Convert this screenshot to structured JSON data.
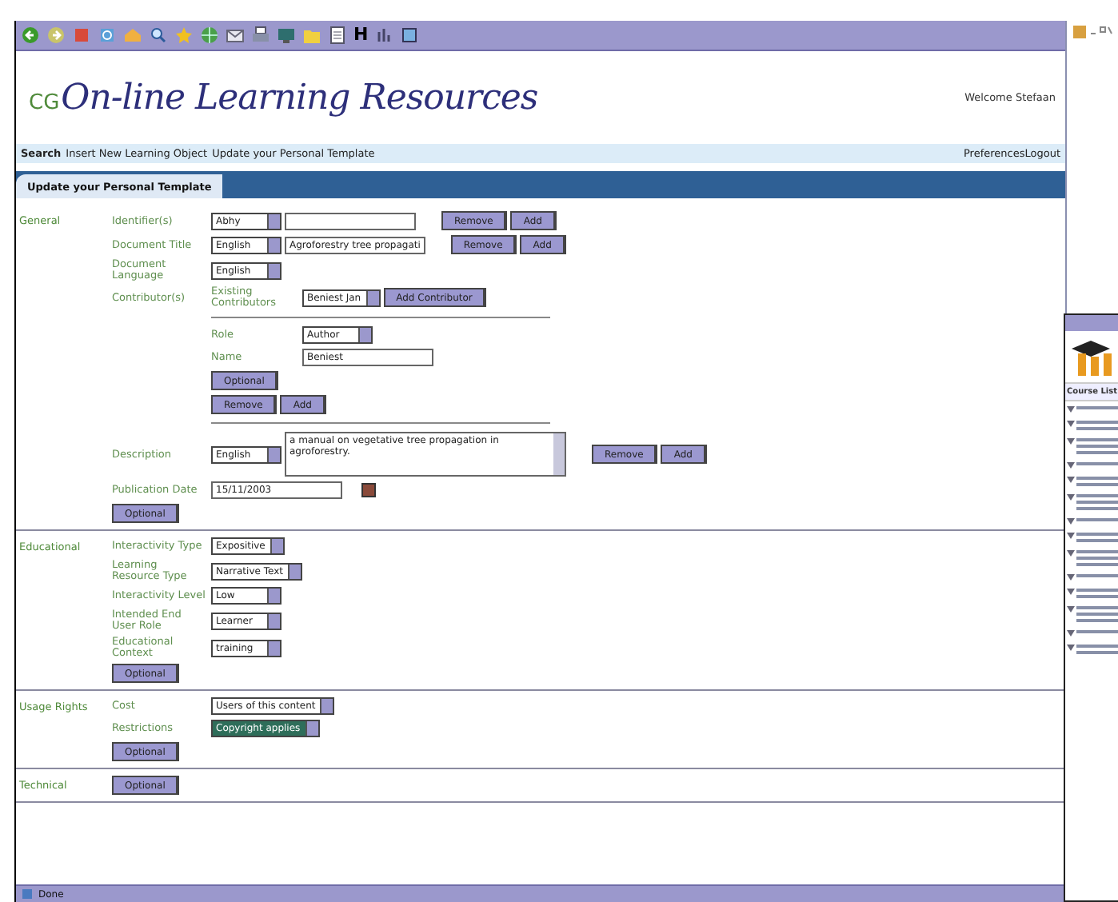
{
  "toolbar": {
    "letter_button": "H"
  },
  "header": {
    "logo_prefix": "CG",
    "logo_title": "On-line Learning Resources",
    "welcome": "Welcome Stefaan"
  },
  "nav": {
    "left": [
      {
        "label": "Search",
        "selected": true
      },
      {
        "label": "Insert New Learning Object",
        "selected": false
      },
      {
        "label": "Update your Personal Template",
        "selected": false
      }
    ],
    "right": [
      "Preferences",
      "Logout"
    ]
  },
  "tabs": [
    {
      "label": "Update your Personal Template",
      "selected": true
    }
  ],
  "sections": [
    {
      "title": "General",
      "rows": [
        {
          "kind": "field",
          "label": "Identifier(s)",
          "controls": [
            {
              "kind": "select",
              "value": "Abhy",
              "focused": false
            },
            {
              "kind": "input"
            },
            {
              "kind": "button",
              "label": "Remove"
            },
            {
              "kind": "button",
              "label": "Add"
            }
          ]
        },
        {
          "kind": "field",
          "label": "Document Title",
          "controls": [
            {
              "kind": "select",
              "value": "English",
              "focused": false
            },
            {
              "kind": "input",
              "value": "Agroforestry tree propagati"
            },
            {
              "kind": "button",
              "label": "Remove"
            },
            {
              "kind": "button",
              "label": "Add"
            }
          ]
        },
        {
          "kind": "field",
          "label": "Document Language",
          "controls": [
            {
              "kind": "select",
              "value": "English",
              "focused": false
            }
          ]
        },
        {
          "kind": "field",
          "label": "Contributor(s)",
          "controls": [
            {
              "kind": "sublabel",
              "label": "Existing Contributors"
            },
            {
              "kind": "select",
              "value": "Beniest Jan",
              "focused": false
            },
            {
              "kind": "button",
              "label": "Add Contributor"
            }
          ]
        },
        {
          "kind": "separator"
        },
        {
          "kind": "field",
          "controls": [
            {
              "kind": "sublabel",
              "label": "Role"
            },
            {
              "kind": "select",
              "value": "Author",
              "focused": false
            }
          ]
        },
        {
          "kind": "field",
          "controls": [
            {
              "kind": "sublabel",
              "label": "Name"
            },
            {
              "kind": "input",
              "value": "Beniest"
            }
          ]
        },
        {
          "kind": "field",
          "controls": [
            {
              "kind": "button",
              "label": "Optional"
            }
          ]
        },
        {
          "kind": "field",
          "controls": [
            {
              "kind": "button",
              "label": "Remove"
            },
            {
              "kind": "button",
              "label": "Add"
            }
          ]
        },
        {
          "kind": "separator"
        },
        {
          "kind": "field",
          "label": "Description",
          "controls": [
            {
              "kind": "select",
              "value": "English",
              "focused": false
            },
            {
              "kind": "textarea",
              "value": "a manual on vegetative tree propagation in agroforestry."
            },
            {
              "kind": "button",
              "label": "Remove"
            },
            {
              "kind": "button",
              "label": "Add"
            }
          ]
        },
        {
          "kind": "field",
          "label": "Publication Date",
          "controls": [
            {
              "kind": "input",
              "value": "15/11/2003"
            },
            {
              "kind": "calendar"
            }
          ]
        }
      ],
      "footer_button": "Optional"
    },
    {
      "title": "Educational",
      "rows": [
        {
          "kind": "field",
          "label": "Interactivity Type",
          "controls": [
            {
              "kind": "select",
              "value": "Expositive",
              "focused": false
            }
          ]
        },
        {
          "kind": "field",
          "label": "Learning Resource Type",
          "controls": [
            {
              "kind": "select",
              "value": "Narrative Text",
              "focused": false
            }
          ]
        },
        {
          "kind": "field",
          "label": "Interactivity Level",
          "controls": [
            {
              "kind": "select",
              "value": "Low",
              "focused": false
            }
          ]
        },
        {
          "kind": "field",
          "label": "Intended End User Role",
          "controls": [
            {
              "kind": "select",
              "value": "Learner",
              "focused": false
            }
          ]
        },
        {
          "kind": "field",
          "label": "Educational Context",
          "controls": [
            {
              "kind": "select",
              "value": "training",
              "focused": false
            }
          ]
        }
      ],
      "footer_button": "Optional"
    },
    {
      "title": "Usage Rights",
      "rows": [
        {
          "kind": "field",
          "label": "Cost",
          "controls": [
            {
              "kind": "select",
              "value": "Users of this content",
              "focused": false
            }
          ]
        },
        {
          "kind": "field",
          "label": "Restrictions",
          "controls": [
            {
              "kind": "select",
              "value": "Copyright applies",
              "focused": true
            }
          ]
        }
      ],
      "footer_button": "Optional"
    },
    {
      "title": "Technical",
      "footer_button": "Optional"
    }
  ],
  "status_bar": {
    "text": "Done"
  },
  "side_window": {
    "header": "Course List"
  }
}
